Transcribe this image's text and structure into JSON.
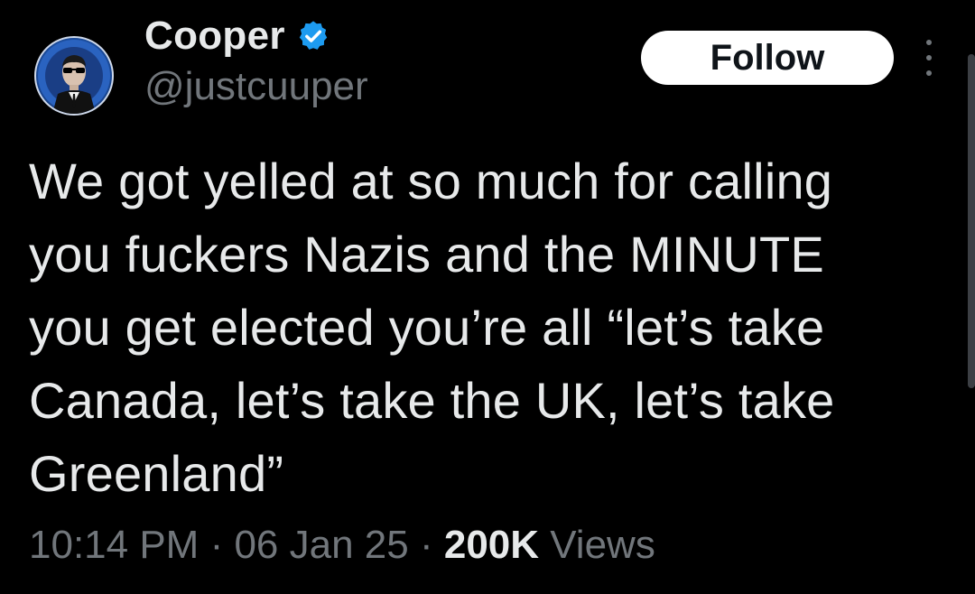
{
  "author": {
    "display_name": "Cooper",
    "handle": "@justcuuper",
    "verified_icon": "verified-badge-icon",
    "avatar_icon": "avatar-image"
  },
  "actions": {
    "follow_label": "Follow",
    "more_icon": "more-options-icon"
  },
  "tweet": {
    "text": "We got yelled at so much for calling\nyou fuckers Nazis and the MINUTE\nyou get elected you’re all “let’s take\nCanada, let’s take the UK, let’s take\nGreenland”"
  },
  "meta": {
    "time": "10:14 PM",
    "sep1": " · ",
    "date": "06 Jan 25",
    "sep2": " · ",
    "views_count": "200K",
    "views_label": " Views"
  },
  "colors": {
    "background": "#000000",
    "text_primary": "#e7e9ea",
    "text_secondary": "#71767b",
    "verified_blue": "#1d9bf0",
    "follow_bg": "#ffffff"
  }
}
